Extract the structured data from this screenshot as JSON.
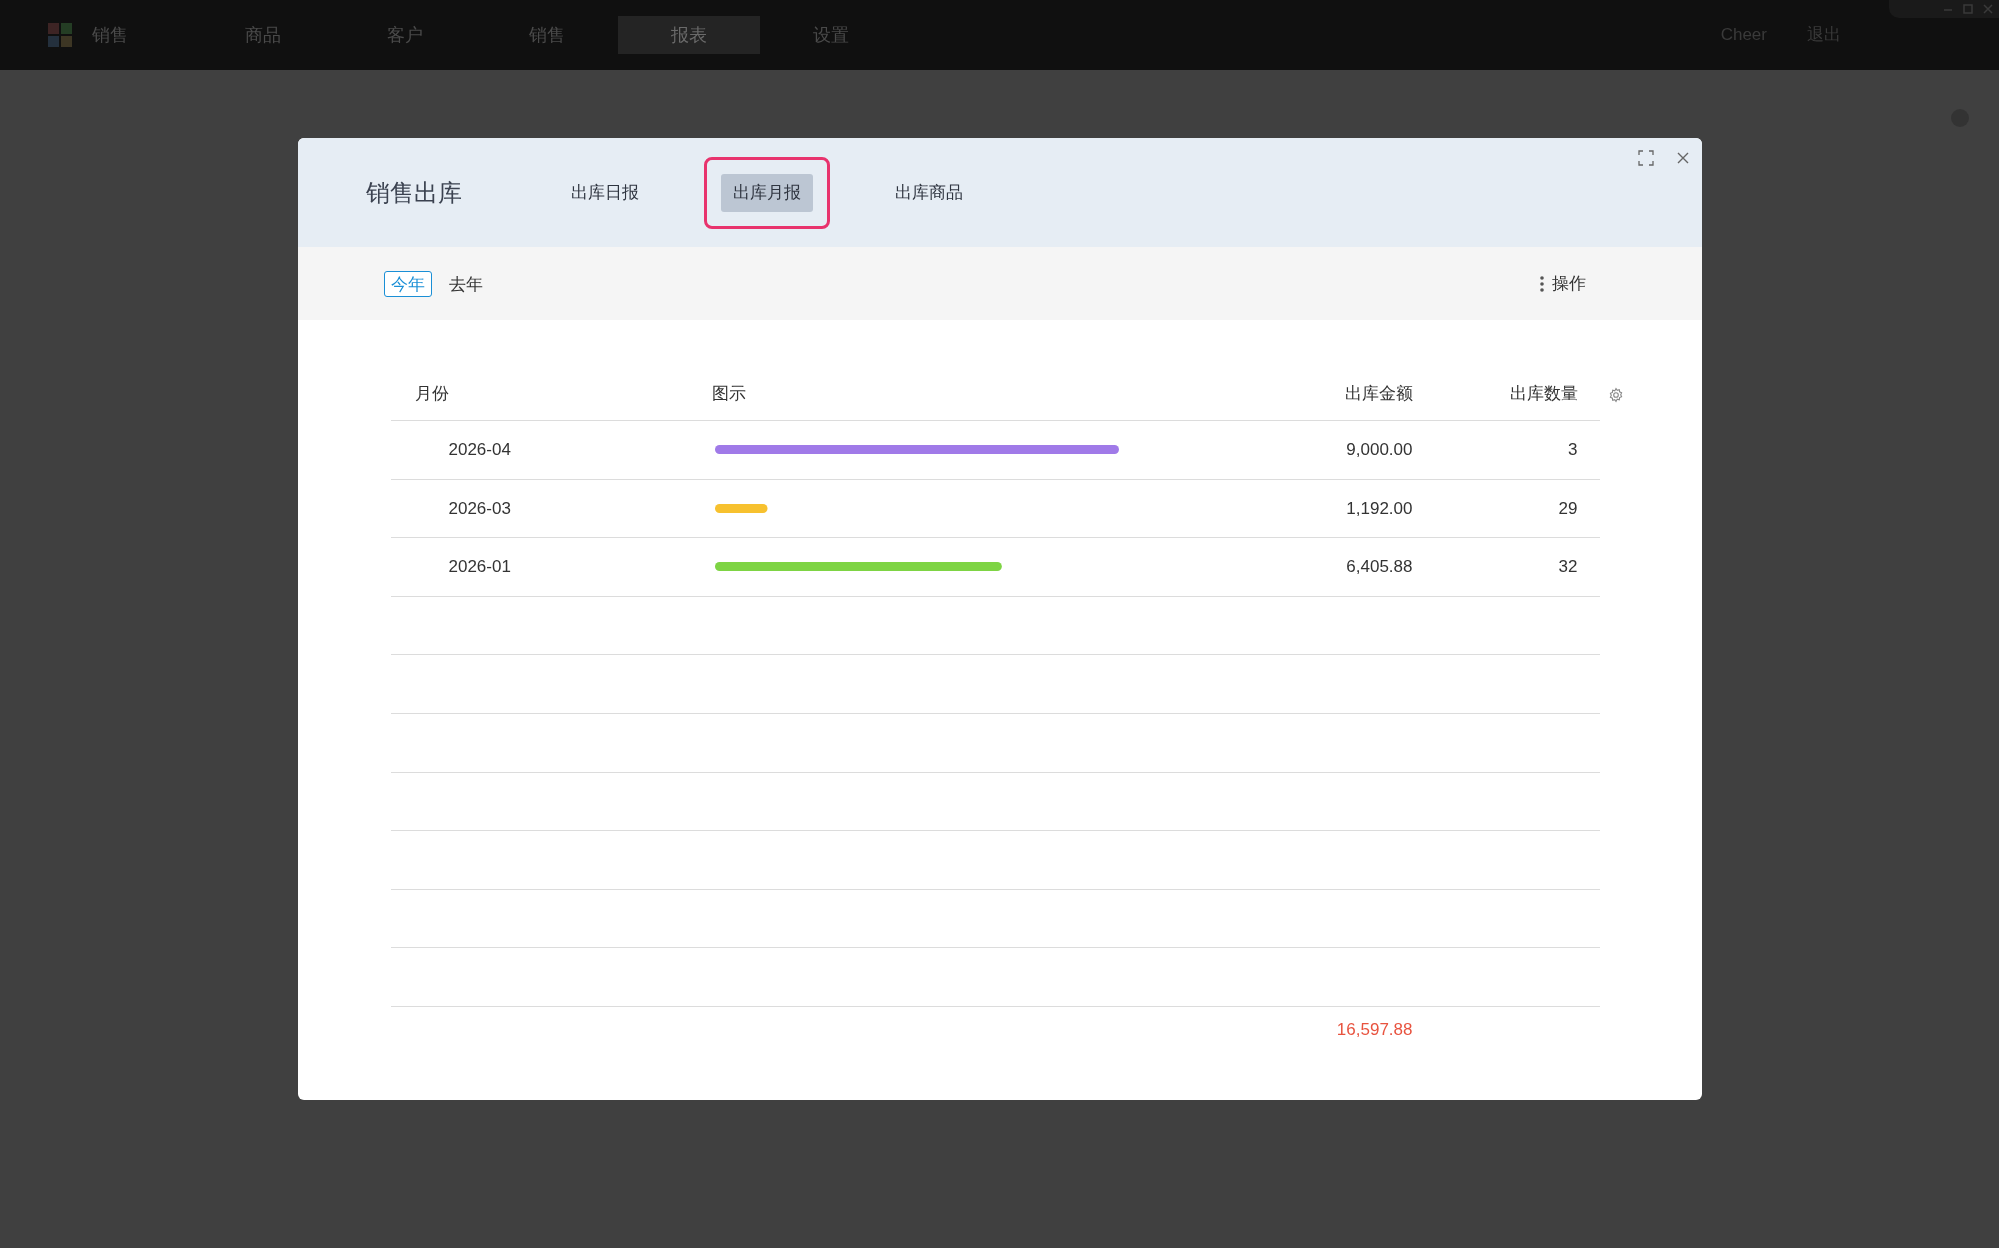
{
  "top_nav": {
    "items": [
      {
        "label": "销售",
        "selected": false
      },
      {
        "label": "商品",
        "selected": false
      },
      {
        "label": "客户",
        "selected": false
      },
      {
        "label": "销售",
        "selected": false
      },
      {
        "label": "报表",
        "selected": true
      },
      {
        "label": "设置",
        "selected": false
      }
    ],
    "user": "Cheer",
    "logout": "退出"
  },
  "dialog": {
    "title": "销售出库",
    "tabs": [
      {
        "label": "出库日报",
        "selected": false
      },
      {
        "label": "出库月报",
        "selected": true
      },
      {
        "label": "出库商品",
        "selected": false
      }
    ],
    "filters": [
      {
        "label": "今年",
        "selected": true
      },
      {
        "label": "去年",
        "selected": false
      }
    ],
    "actions": "操作",
    "table": {
      "columns": [
        "月份",
        "图示",
        "出库金额",
        "出库数量"
      ],
      "rows": [
        {
          "month": "2026-04",
          "bar": {
            "level": 1,
            "color": "#a07ae8"
          },
          "amount": "9,000.00",
          "quantity": "3"
        },
        {
          "month": "2026-03",
          "bar": {
            "level": 0.13,
            "color": "#f7c12f"
          },
          "amount": "1,192.00",
          "quantity": "29"
        },
        {
          "month": "2026-01",
          "bar": {
            "level": 0.71,
            "color": "#7ed444"
          },
          "amount": "6,405.88",
          "quantity": "32"
        }
      ],
      "total": {
        "amount": "16,597.88"
      }
    }
  }
}
